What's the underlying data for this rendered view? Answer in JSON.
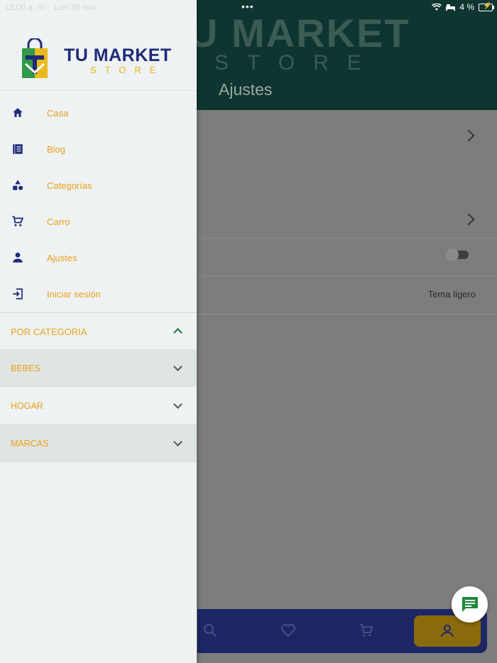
{
  "status_bar": {
    "time": "12:00 a. m.",
    "date": "Lun 28 nov.",
    "dots": "•••",
    "battery": "4 %"
  },
  "background": {
    "brand_line1": "U MARKET",
    "brand_line2": "STORE",
    "page_title": "Ajustes",
    "theme_value": "Tema ligero"
  },
  "drawer": {
    "logo": {
      "line1": "TU MARKET",
      "line2": "STORE"
    },
    "menu": [
      {
        "label": "Casa",
        "icon": "home-icon"
      },
      {
        "label": "Blog",
        "icon": "article-icon"
      },
      {
        "label": "Categorías",
        "icon": "shapes-icon"
      },
      {
        "label": "Carro",
        "icon": "cart-icon"
      },
      {
        "label": "Ajustes",
        "icon": "person-icon"
      },
      {
        "label": "Iniciar sesión",
        "icon": "login-icon"
      }
    ],
    "categories_header": "POR CATEGORIA",
    "categories": [
      {
        "label": "BEBES"
      },
      {
        "label": "HOGAR"
      },
      {
        "label": "MARCAS"
      }
    ]
  },
  "colors": {
    "accent_orange": "#e9a11b",
    "brand_navy": "#1f2a7a",
    "header_dark": "#0f3530",
    "nav_bar": "#1e2766",
    "chat_green": "#1f8a3a"
  }
}
